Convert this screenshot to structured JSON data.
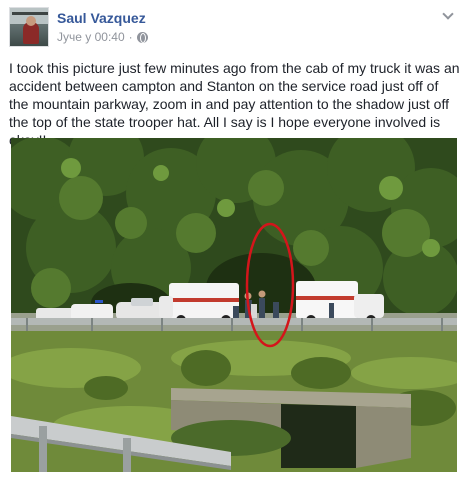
{
  "post": {
    "author": "Saul Vazquez",
    "timestamp": "Јуче у 00:40",
    "separator": "·",
    "privacy_icon": "globe-icon",
    "options_icon": "chevron-down-icon",
    "message": "I took this picture just few minutes ago from the cab of my truck it was an accident between campton and Stanton on the service road just off of the mountain parkway, zoom in and pay attention to the shadow just off the top of the state trooper hat. All I say is I hope everyone involved is okay!!"
  },
  "colors": {
    "author_link": "#365899",
    "meta_text": "#90949c",
    "body_text": "#1d2129",
    "highlight_circle": "#d4151b"
  }
}
